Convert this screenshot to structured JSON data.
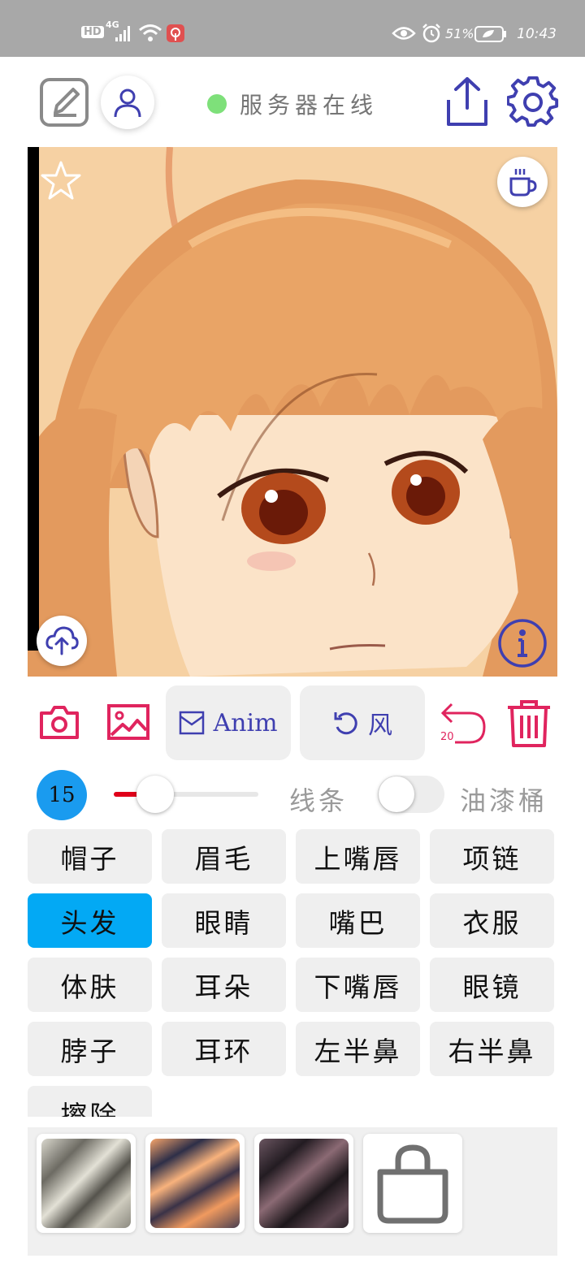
{
  "status_bar": {
    "network_badge": "HD",
    "network_type": "4G",
    "battery_percent": "51%",
    "time": "10:43",
    "icons": [
      "signal-icon",
      "wifi-icon",
      "notification-icon",
      "eye-icon",
      "alarm-icon",
      "battery-icon"
    ]
  },
  "header": {
    "server_status": "服务器在线",
    "server_status_color": "#7ee07a",
    "icons": [
      "draw-icon",
      "user-icon",
      "share-icon",
      "settings-icon"
    ]
  },
  "canvas": {
    "icons": [
      "star-icon",
      "coffee-icon",
      "cloud-upload-icon",
      "info-icon"
    ]
  },
  "toolbar": {
    "anim_label": "Anim",
    "style_label": "风",
    "undo_count": "20",
    "icons": [
      "camera-icon",
      "image-icon",
      "mail-icon",
      "rotate-icon",
      "undo-icon",
      "trash-icon"
    ]
  },
  "brush": {
    "size": "15",
    "slider_level": 0.1,
    "line_mode_label": "线条",
    "fill_mode_label": "油漆桶",
    "fill_mode_on": false
  },
  "parts": [
    {
      "label": "帽子",
      "selected": false
    },
    {
      "label": "眉毛",
      "selected": false
    },
    {
      "label": "上嘴唇",
      "selected": false
    },
    {
      "label": "项链",
      "selected": false
    },
    {
      "label": "头发",
      "selected": true
    },
    {
      "label": "眼睛",
      "selected": false
    },
    {
      "label": "嘴巴",
      "selected": false
    },
    {
      "label": "衣服",
      "selected": false
    },
    {
      "label": "体肤",
      "selected": false
    },
    {
      "label": "耳朵",
      "selected": false
    },
    {
      "label": "下嘴唇",
      "selected": false
    },
    {
      "label": "眼镜",
      "selected": false
    },
    {
      "label": "脖子",
      "selected": false
    },
    {
      "label": "耳环",
      "selected": false
    },
    {
      "label": "左半鼻",
      "selected": false
    },
    {
      "label": "右半鼻",
      "selected": false
    },
    {
      "label": "擦除",
      "selected": false
    }
  ],
  "colors": {
    "accent": "#3f3fb0",
    "danger": "#e0245e",
    "selected_part": "#03a9f4"
  }
}
